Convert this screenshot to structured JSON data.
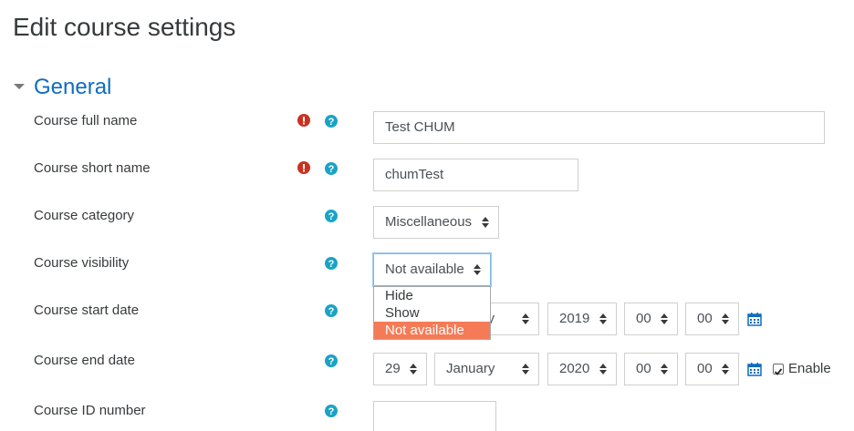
{
  "page": {
    "title": "Edit course settings"
  },
  "section": {
    "title": "General"
  },
  "fields": {
    "full_name": {
      "label": "Course full name",
      "value": "Test CHUM"
    },
    "short_name": {
      "label": "Course short name",
      "value": "chumTest"
    },
    "category": {
      "label": "Course category",
      "value": "Miscellaneous"
    },
    "visibility": {
      "label": "Course visibility",
      "value": "Not available",
      "options": [
        "Hide",
        "Show",
        "Not available"
      ],
      "selected_index": 2
    },
    "start_date": {
      "label": "Course start date",
      "month_fragment": "y",
      "year": "2019",
      "hour": "00",
      "minute": "00"
    },
    "end_date": {
      "label": "Course end date",
      "day": "29",
      "month": "January",
      "year": "2020",
      "hour": "00",
      "minute": "00",
      "enable_label": "Enable",
      "enabled": true
    },
    "id_number": {
      "label": "Course ID number",
      "value": ""
    }
  },
  "icons": {
    "required": "exclamation-circle-icon",
    "help": "question-circle-icon",
    "calendar": "calendar-icon",
    "section_toggle": "caret-down-icon"
  },
  "colors": {
    "section_title": "#0f6cbf",
    "required": "#ca3120",
    "help": "#1aa3c6",
    "selected_option": "#f57b57",
    "calendar": "#0f6cbf"
  }
}
